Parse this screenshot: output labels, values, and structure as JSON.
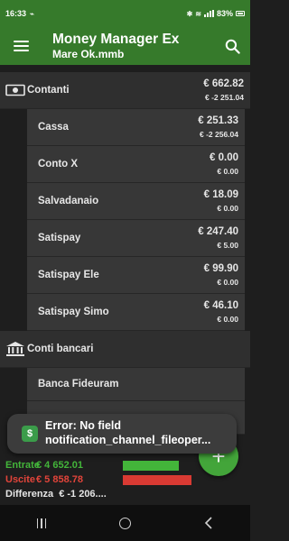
{
  "status_bar": {
    "time": "16:33",
    "battery": "83%"
  },
  "app_bar": {
    "title": "Money Manager Ex",
    "subtitle": "Mare  Ok.mmb",
    "icons": [
      "menu-icon",
      "search-icon"
    ]
  },
  "groups": [
    {
      "label": "Contanti",
      "icon": "cash-icon",
      "amount": "€ 662.82",
      "sub_amount": "€ -2 251.04",
      "accounts": [
        {
          "label": "Cassa",
          "amount": "€ 251.33",
          "sub_amount": "€ -2 256.04"
        },
        {
          "label": "Conto X",
          "amount": "€ 0.00",
          "sub_amount": "€ 0.00"
        },
        {
          "label": "Salvadanaio",
          "amount": "€ 18.09",
          "sub_amount": "€ 0.00"
        },
        {
          "label": "Satispay",
          "amount": "€ 247.40",
          "sub_amount": "€ 5.00"
        },
        {
          "label": "Satispay Ele",
          "amount": "€ 99.90",
          "sub_amount": "€ 0.00"
        },
        {
          "label": "Satispay Simo",
          "amount": "€ 46.10",
          "sub_amount": "€ 0.00"
        }
      ]
    },
    {
      "label": "Conti bancari",
      "icon": "bank-icon",
      "accounts": [
        {
          "label": "Banca Fideuram"
        }
      ]
    }
  ],
  "footer": {
    "income_label": "Entrate",
    "income_value": "€ 4 652.01",
    "expense_label": "Uscite",
    "expense_value": "€ 5 858.78",
    "difference_label": "Differenza",
    "difference_value": "€ -1 206...."
  },
  "toast": {
    "line1": "Error: No field",
    "line2": "notification_channel_fileoper..."
  },
  "fab": {
    "icon": "plus-icon",
    "label": "+"
  },
  "colors": {
    "app_bar": "#367a2b",
    "income": "#43b53a",
    "expense": "#e2443a",
    "background": "#1e1e1e"
  }
}
